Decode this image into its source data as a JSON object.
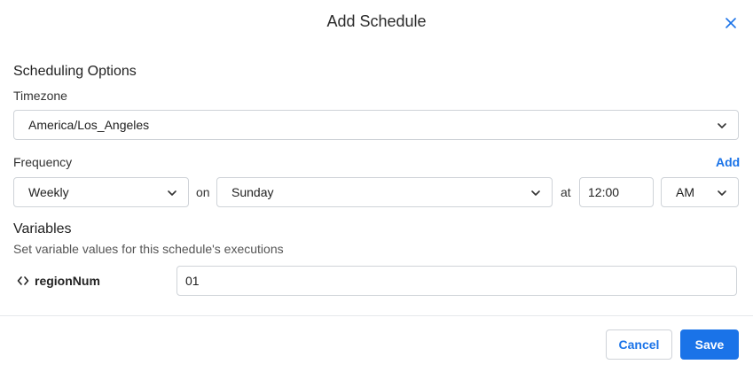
{
  "dialog": {
    "title": "Add Schedule"
  },
  "scheduling": {
    "heading": "Scheduling Options",
    "timezone_label": "Timezone",
    "timezone_value": "America/Los_Angeles",
    "frequency_label": "Frequency",
    "add_link": "Add",
    "frequency_value": "Weekly",
    "on_label": "on",
    "day_value": "Sunday",
    "at_label": "at",
    "time_value": "12:00",
    "ampm_value": "AM"
  },
  "variables": {
    "heading": "Variables",
    "description": "Set variable values for this schedule's executions",
    "items": [
      {
        "name": "regionNum",
        "value": "01"
      }
    ]
  },
  "footer": {
    "cancel_label": "Cancel",
    "save_label": "Save"
  },
  "colors": {
    "accent": "#1a73e8",
    "border": "#cfd3d8"
  },
  "icons": {
    "close": "close-icon",
    "chevron": "chevron-down-icon",
    "variable": "code-brackets-icon"
  }
}
